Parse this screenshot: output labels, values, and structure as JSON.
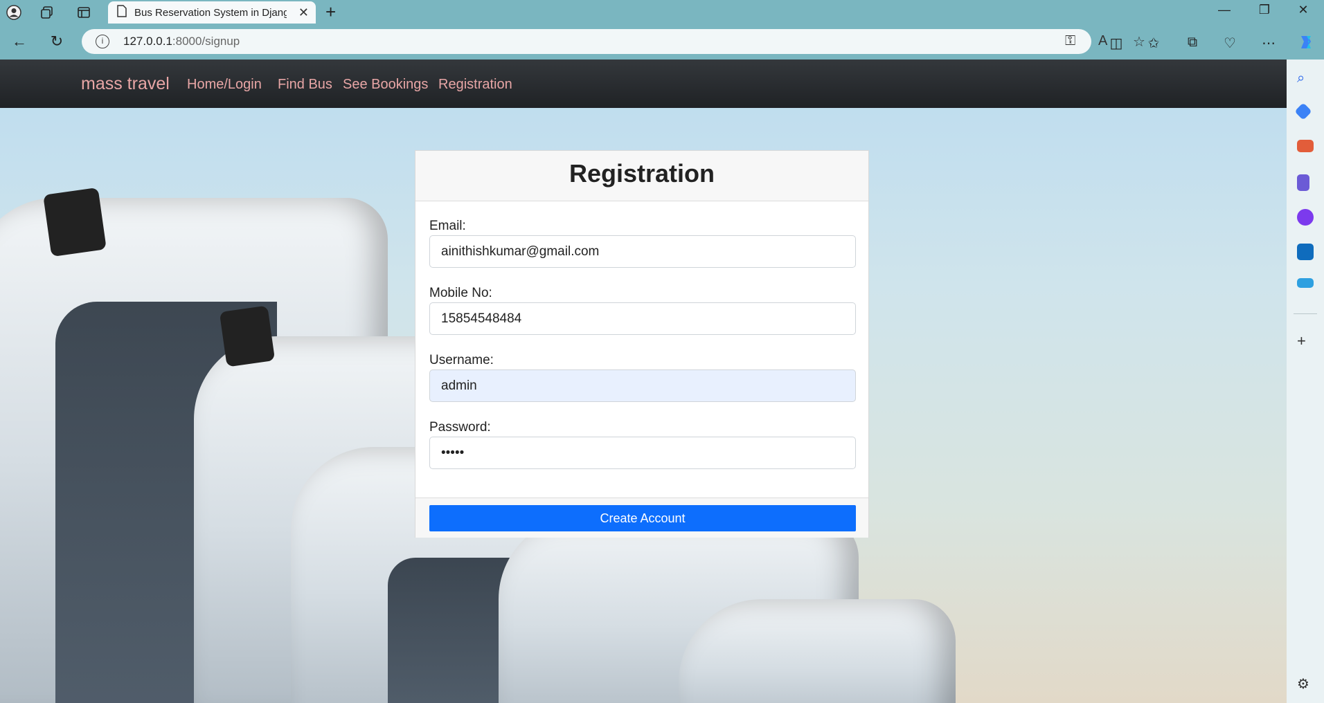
{
  "browser": {
    "tab_title": "Bus Reservation System in Djang",
    "url_host": "127.0.0.1",
    "url_path": ":8000/signup"
  },
  "navbar": {
    "brand": "mass travel",
    "links": [
      "Home/Login",
      "Find Bus",
      "See Bookings",
      "Registration"
    ]
  },
  "form": {
    "title": "Registration",
    "email_label": "Email:",
    "email_value": "ainithishkumar@gmail.com",
    "mobile_label": "Mobile No:",
    "mobile_value": "15854548484",
    "username_label": "Username:",
    "username_value": "admin",
    "password_label": "Password:",
    "password_value": "•••••",
    "submit_label": "Create Account"
  },
  "colors": {
    "accent": "#0d6efd",
    "nav_link": "#e8a6a6",
    "navbar_bg": "#26292c",
    "chrome_bg": "#7ab6c0"
  }
}
